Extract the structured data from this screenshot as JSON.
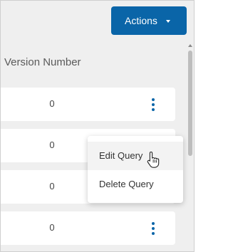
{
  "toolbar": {
    "actions_label": "Actions"
  },
  "table": {
    "column_header": "Version Number",
    "rows": [
      {
        "version": "0"
      },
      {
        "version": "0"
      },
      {
        "version": "0"
      },
      {
        "version": "0"
      }
    ]
  },
  "context_menu": {
    "items": [
      {
        "label": "Edit Query"
      },
      {
        "label": "Delete Query"
      }
    ]
  },
  "colors": {
    "primary": "#0a65a8",
    "background": "#efefef"
  }
}
